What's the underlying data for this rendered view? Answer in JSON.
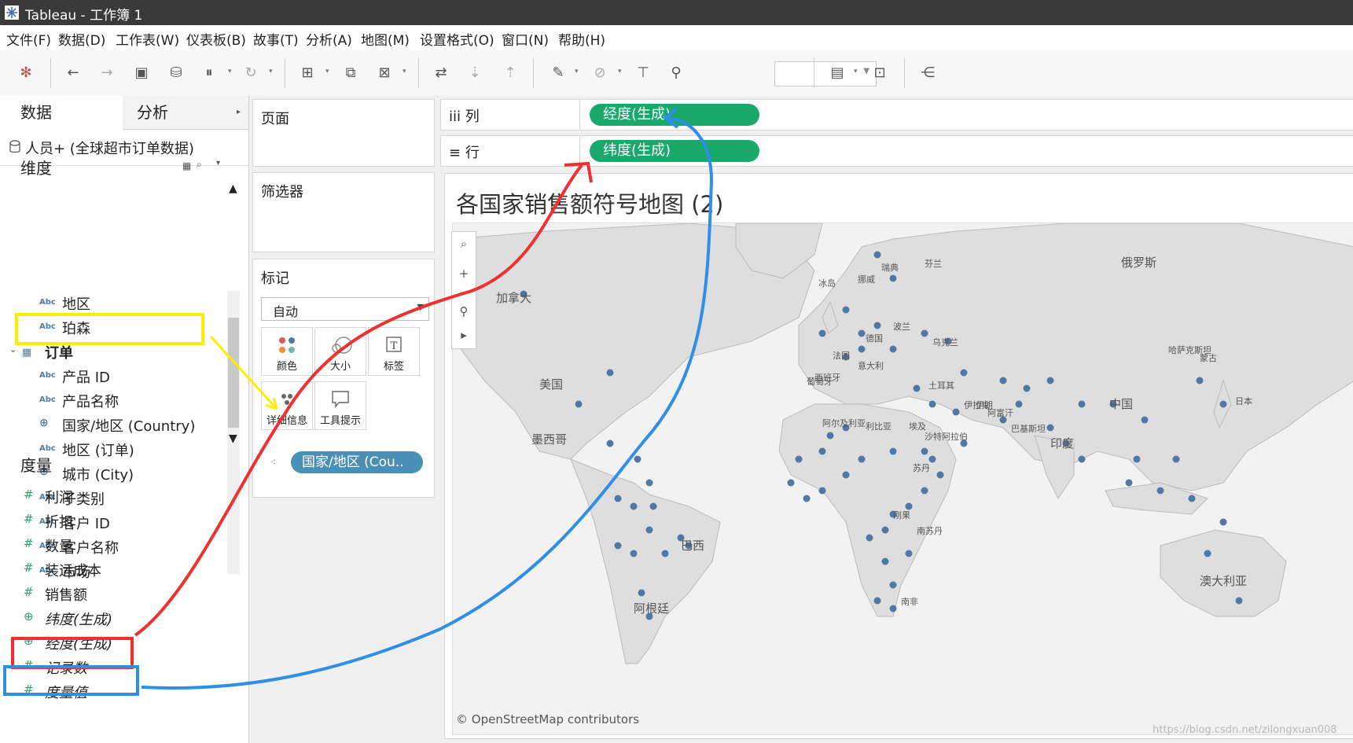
{
  "window": {
    "title": "Tableau - 工作簿 1"
  },
  "menu": [
    "文件(F)",
    "数据(D)",
    "工作表(W)",
    "仪表板(B)",
    "故事(T)",
    "分析(A)",
    "地图(M)",
    "设置格式(O)",
    "窗口(N)",
    "帮助(H)"
  ],
  "toolbar": {
    "icons": [
      "tableau-logo-icon",
      "back-icon",
      "forward-icon",
      "save-icon",
      "new-datasource-icon",
      "pause-icon",
      "refresh-icon",
      "new-sheet-icon",
      "duplicate-icon",
      "clear-icon",
      "swap-icon",
      "sort-asc-icon",
      "sort-desc-icon",
      "highlight-icon",
      "paperclip-icon",
      "label-icon",
      "pin-icon",
      "show-cards-icon",
      "presentation-icon",
      "share-icon"
    ]
  },
  "left": {
    "tabs": {
      "data": "数据",
      "analysis": "分析"
    },
    "datasource": "人员+ (全球超市订单数据)",
    "dimensions_title": "维度",
    "dimensions": [
      {
        "type": "abc",
        "label": "地区"
      },
      {
        "type": "abc",
        "label": "珀森"
      },
      {
        "type": "folder",
        "label": "订单"
      },
      {
        "type": "abc",
        "label": "产品 ID"
      },
      {
        "type": "abc",
        "label": "产品名称"
      },
      {
        "type": "geo",
        "label": "国家/地区 (Country)"
      },
      {
        "type": "abc",
        "label": "地区 (订单)"
      },
      {
        "type": "geo",
        "label": "城市 (City)"
      },
      {
        "type": "abc",
        "label": "子类别"
      },
      {
        "type": "abc",
        "label": "客户 ID"
      },
      {
        "type": "abc",
        "label": "客户名称"
      },
      {
        "type": "abc",
        "label": "市场"
      }
    ],
    "measures_title": "度量",
    "measures": [
      {
        "type": "num",
        "label": "利润"
      },
      {
        "type": "num",
        "label": "折扣"
      },
      {
        "type": "num",
        "label": "数量"
      },
      {
        "type": "num",
        "label": "装运成本"
      },
      {
        "type": "num",
        "label": "销售额"
      },
      {
        "type": "geo",
        "label": "纬度(生成)"
      },
      {
        "type": "geo",
        "label": "经度(生成)"
      },
      {
        "type": "num",
        "label": "记录数"
      },
      {
        "type": "num",
        "label": "度量值"
      }
    ],
    "abc_tag": "Abc"
  },
  "cards": {
    "pages": "页面",
    "filters": "筛选器",
    "marks": "标记",
    "mark_type": "自动",
    "buttons": [
      "颜色",
      "大小",
      "标签",
      "详细信息",
      "工具提示"
    ],
    "detail_pill": "国家/地区 (Cou.."
  },
  "shelves": {
    "columns_label": "列",
    "rows_label": "行",
    "columns_pill": "经度(生成)",
    "rows_pill": "纬度(生成)"
  },
  "view": {
    "title": "各国家销售额符号地图 (2)",
    "credit": "© OpenStreetMap contributors",
    "watermark": "https://blog.csdn.net/zilongxuan008",
    "map_labels": [
      "加拿大",
      "美国",
      "墨西哥",
      "巴西",
      "阿根廷",
      "俄罗斯",
      "中国",
      "印度",
      "澳大利亚",
      "哈萨克斯坦",
      "蒙古",
      "日本",
      "伊朗",
      "阿尔及利亚",
      "利比亚",
      "埃及",
      "沙特阿拉伯",
      "巴基斯坦",
      "阿富汗",
      "南非",
      "刚果",
      "南苏丹",
      "土耳其",
      "法国",
      "德国",
      "意大利",
      "西班牙",
      "瑞典",
      "芬兰",
      "波兰",
      "乌克兰",
      "伊拉克",
      "苏丹",
      "挪威",
      "冰岛",
      "葡萄牙"
    ]
  },
  "colors": {
    "accent_pill": "#18a96b",
    "detail_pill": "#4a8fb6",
    "map_dot": "#4e79a7",
    "red_annotation": "#f03030",
    "blue_annotation": "#2e8ee8",
    "yellow_annotation": "#ffee00"
  }
}
